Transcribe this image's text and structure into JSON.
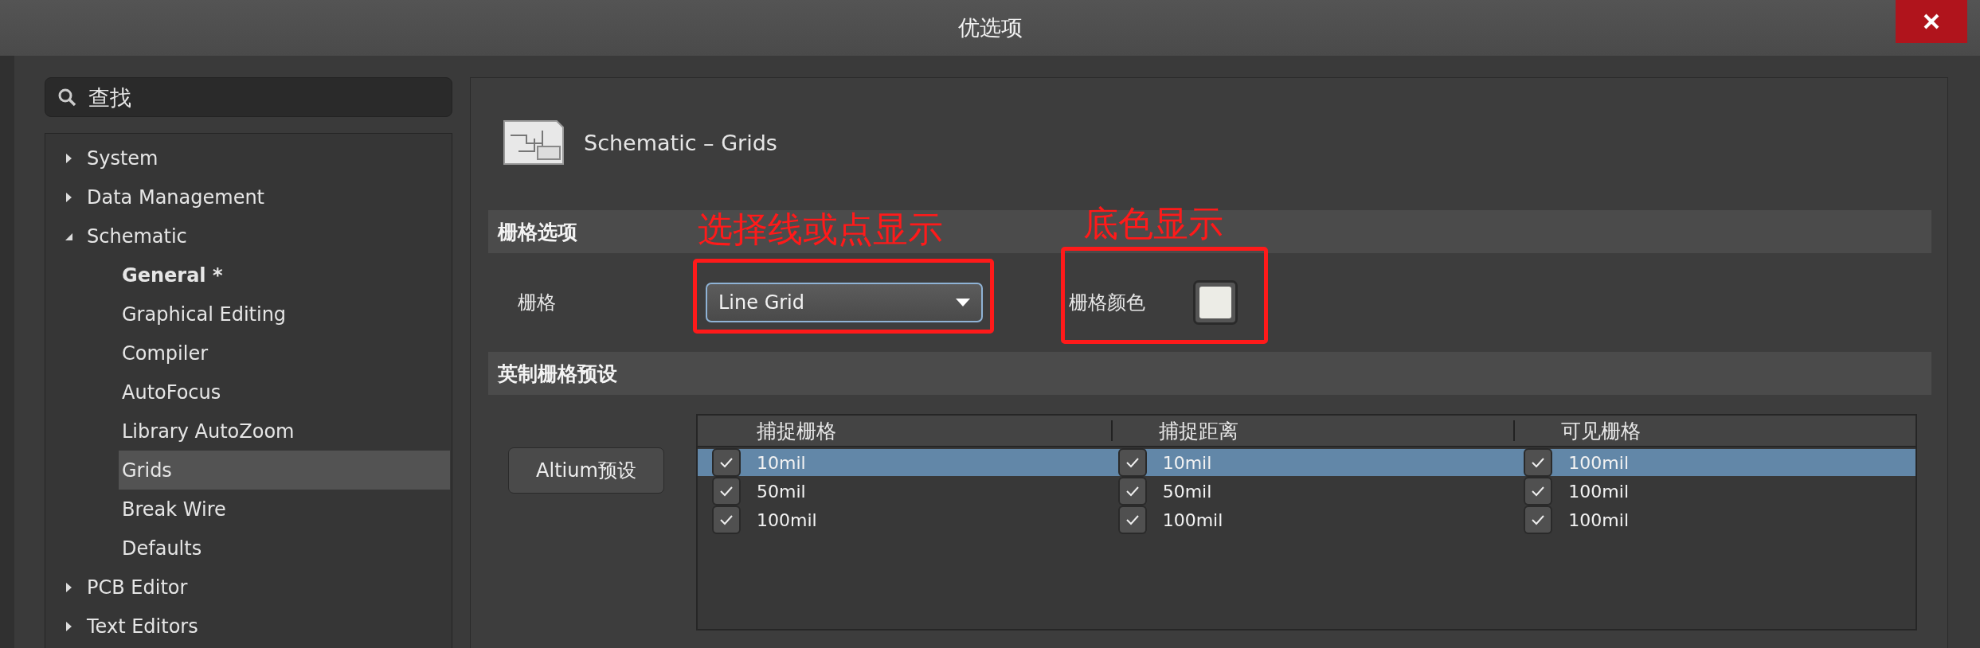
{
  "window": {
    "title": "优选项"
  },
  "search": {
    "placeholder": "查找"
  },
  "tree": [
    {
      "label": "System",
      "expanded": false,
      "selected": false
    },
    {
      "label": "Data Management",
      "expanded": false,
      "selected": false
    },
    {
      "label": "Schematic",
      "expanded": true,
      "selected": false,
      "children": [
        {
          "label": "General *",
          "modified": true,
          "selected": false
        },
        {
          "label": "Graphical Editing",
          "modified": false,
          "selected": false
        },
        {
          "label": "Compiler",
          "modified": false,
          "selected": false
        },
        {
          "label": "AutoFocus",
          "modified": false,
          "selected": false
        },
        {
          "label": "Library AutoZoom",
          "modified": false,
          "selected": false
        },
        {
          "label": "Grids",
          "modified": false,
          "selected": true
        },
        {
          "label": "Break Wire",
          "modified": false,
          "selected": false
        },
        {
          "label": "Defaults",
          "modified": false,
          "selected": false
        }
      ]
    },
    {
      "label": "PCB Editor",
      "expanded": false,
      "selected": false
    },
    {
      "label": "Text Editors",
      "expanded": false,
      "selected": false
    }
  ],
  "page": {
    "title": "Schematic – Grids"
  },
  "grid_options": {
    "section": "栅格选项",
    "grid_label": "栅格",
    "grid_value": "Line Grid",
    "color_label": "栅格颜色",
    "color": "#ecece6"
  },
  "annotations": [
    "选择线或点显示",
    "底色显示"
  ],
  "imperial_presets": {
    "section": "英制栅格预设",
    "preset_button": "Altium预设",
    "columns": [
      "捕捉栅格",
      "捕捉距离",
      "可见栅格"
    ],
    "rows": [
      {
        "selected": true,
        "cells": [
          {
            "checked": true,
            "value": "10mil"
          },
          {
            "checked": true,
            "value": "10mil"
          },
          {
            "checked": true,
            "value": "100mil"
          }
        ]
      },
      {
        "selected": false,
        "cells": [
          {
            "checked": true,
            "value": "50mil"
          },
          {
            "checked": true,
            "value": "50mil"
          },
          {
            "checked": true,
            "value": "100mil"
          }
        ]
      },
      {
        "selected": false,
        "cells": [
          {
            "checked": true,
            "value": "100mil"
          },
          {
            "checked": true,
            "value": "100mil"
          },
          {
            "checked": true,
            "value": "100mil"
          }
        ]
      }
    ]
  }
}
